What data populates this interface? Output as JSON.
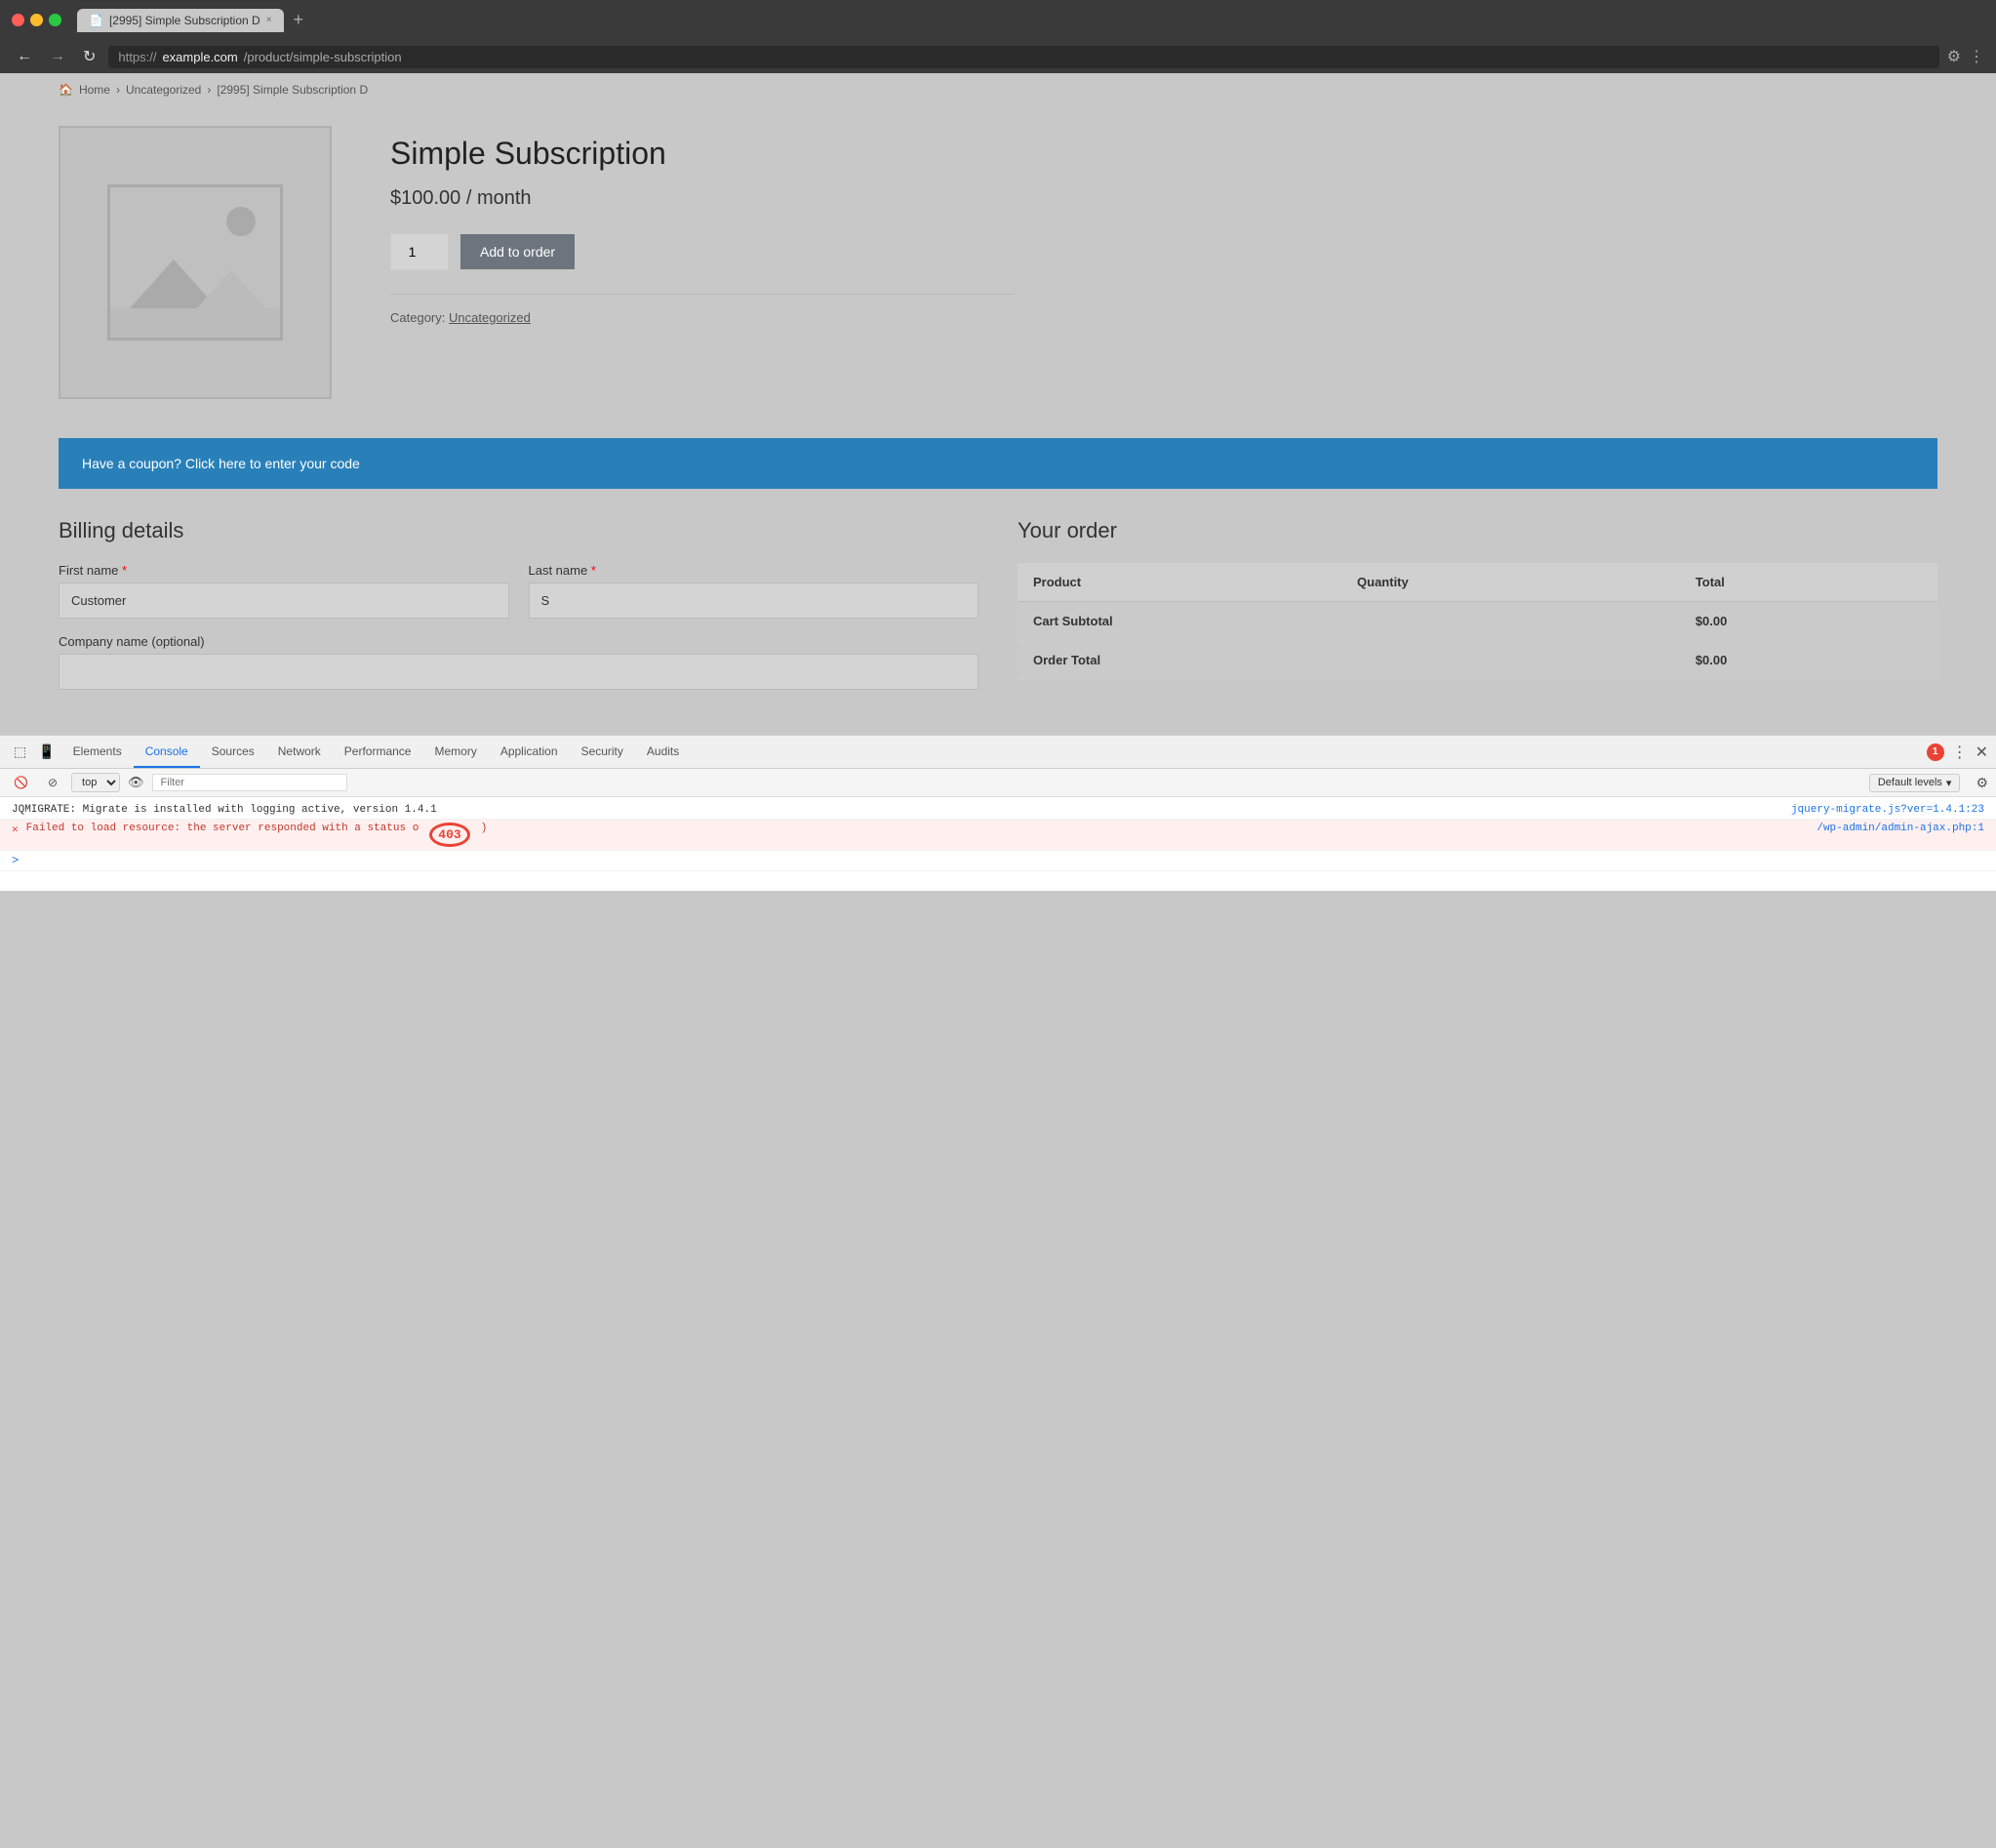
{
  "browser": {
    "tab_title": "[2995] Simple Subscription D",
    "tab_close": "×",
    "tab_new": "+",
    "nav_back": "←",
    "nav_forward": "→",
    "nav_refresh": "↻",
    "address_protocol": "https://",
    "address_domain": "example.com",
    "address_path": "/product/simple-subscription"
  },
  "breadcrumb": {
    "home": "Home",
    "separator1": "›",
    "uncategorized": "Uncategorized",
    "separator2": "›",
    "current": "[2995] Simple Subscription D"
  },
  "product": {
    "title": "Simple Subscription",
    "price": "$100.00",
    "period": "/ month",
    "quantity": "1",
    "add_to_order_label": "Add to order",
    "category_label": "Category:",
    "category_value": "Uncategorized"
  },
  "coupon": {
    "text": "Have a coupon? Click here to enter your code"
  },
  "billing": {
    "title": "Billing details",
    "first_name_label": "First name",
    "first_name_value": "Customer",
    "last_name_label": "Last name",
    "last_name_value": "S",
    "company_label": "Company name (optional)"
  },
  "order": {
    "title": "Your order",
    "col_product": "Product",
    "col_quantity": "Quantity",
    "col_total": "Total",
    "cart_subtotal_label": "Cart Subtotal",
    "cart_subtotal_value": "$0.00",
    "order_total_label": "Order Total",
    "order_total_value": "$0.00"
  },
  "devtools": {
    "tabs": [
      "Elements",
      "Console",
      "Sources",
      "Network",
      "Performance",
      "Memory",
      "Application",
      "Security",
      "Audits"
    ],
    "active_tab": "Console",
    "error_count": "1",
    "filter_placeholder": "Filter",
    "levels_label": "Default levels",
    "top_context": "top",
    "console_line1": "JQMIGRATE: Migrate is installed with logging active, version 1.4.1",
    "console_line1_link": "jquery-migrate.js?ver=1.4.1:23",
    "console_line2_prefix": "Failed to load resource: the server responded with a status o",
    "error_code": "403",
    "console_line2_suffix": ")",
    "console_line2_link": "/wp-admin/admin-ajax.php:1",
    "console_prompt": ">"
  }
}
